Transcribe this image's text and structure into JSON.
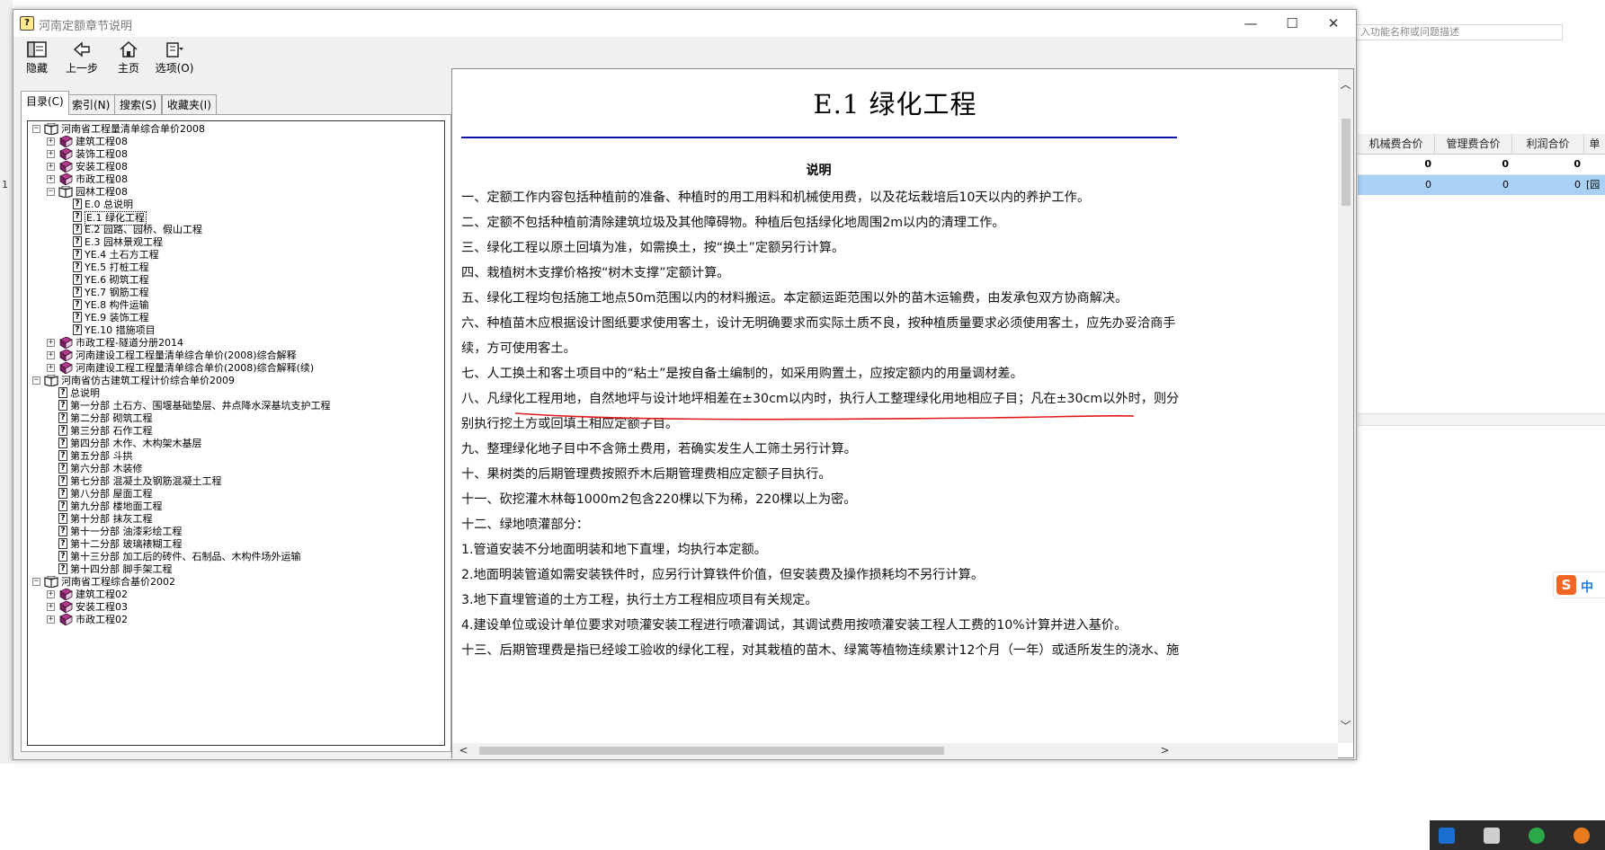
{
  "background_app": {
    "search_placeholder": "入功能名称或问题描述",
    "row_number": "1",
    "columns": [
      "机械费合价",
      "管理费合价",
      "利润合价",
      "单"
    ],
    "row1": [
      "0",
      "0",
      "0"
    ],
    "row2": [
      "0",
      "0",
      "0",
      "[园"
    ]
  },
  "window": {
    "title": "河南定额章节说明",
    "minimize": "—",
    "maximize": "☐",
    "close": "✕"
  },
  "toolbar": {
    "hide": "隐藏",
    "back": "上一步",
    "home": "主页",
    "options": "选项(O)"
  },
  "nav_tabs": [
    "目录(C)",
    "索引(N)",
    "搜索(S)",
    "收藏夹(I)"
  ],
  "tree": [
    {
      "level": 0,
      "type": "book-open",
      "toggle": "−",
      "label": "河南省工程量清单综合单价2008"
    },
    {
      "level": 1,
      "type": "book",
      "toggle": "+",
      "label": "建筑工程08"
    },
    {
      "level": 1,
      "type": "book",
      "toggle": "+",
      "label": "装饰工程08"
    },
    {
      "level": 1,
      "type": "book",
      "toggle": "+",
      "label": "安装工程08"
    },
    {
      "level": 1,
      "type": "book",
      "toggle": "+",
      "label": "市政工程08"
    },
    {
      "level": 1,
      "type": "book-open",
      "toggle": "−",
      "label": "园林工程08"
    },
    {
      "level": 2,
      "type": "page",
      "label": "E.0 总说明"
    },
    {
      "level": 2,
      "type": "page",
      "label": "E.1 绿化工程",
      "selected": true
    },
    {
      "level": 2,
      "type": "page",
      "label": "E.2 园路、园桥、假山工程"
    },
    {
      "level": 2,
      "type": "page",
      "label": "E.3 园林景观工程"
    },
    {
      "level": 2,
      "type": "page",
      "label": "YE.4 土石方工程"
    },
    {
      "level": 2,
      "type": "page",
      "label": "YE.5 打桩工程"
    },
    {
      "level": 2,
      "type": "page",
      "label": "YE.6 砌筑工程"
    },
    {
      "level": 2,
      "type": "page",
      "label": "YE.7 钢筋工程"
    },
    {
      "level": 2,
      "type": "page",
      "label": "YE.8 构件运输"
    },
    {
      "level": 2,
      "type": "page",
      "label": "YE.9 装饰工程"
    },
    {
      "level": 2,
      "type": "page",
      "label": "YE.10 措施项目"
    },
    {
      "level": 1,
      "type": "book",
      "toggle": "+",
      "label": "市政工程-隧道分册2014"
    },
    {
      "level": 1,
      "type": "book",
      "toggle": "+",
      "label": "河南建设工程工程量清单综合单价(2008)综合解释"
    },
    {
      "level": 1,
      "type": "book",
      "toggle": "+",
      "label": "河南建设工程工程量清单综合单价(2008)综合解释(续)"
    },
    {
      "level": 0,
      "type": "book-open",
      "toggle": "−",
      "label": "河南省仿古建筑工程计价综合单价2009"
    },
    {
      "level": 1,
      "type": "page",
      "label": "总说明"
    },
    {
      "level": 1,
      "type": "page",
      "label": "第一分部 土石方、围堰基础垫层、井点降水深基坑支护工程"
    },
    {
      "level": 1,
      "type": "page",
      "label": "第二分部 砌筑工程"
    },
    {
      "level": 1,
      "type": "page",
      "label": "第三分部 石作工程"
    },
    {
      "level": 1,
      "type": "page",
      "label": "第四分部 木作、木构架木基层"
    },
    {
      "level": 1,
      "type": "page",
      "label": "第五分部 斗拱"
    },
    {
      "level": 1,
      "type": "page",
      "label": "第六分部 木装修"
    },
    {
      "level": 1,
      "type": "page",
      "label": "第七分部 混凝土及钢筋混凝土工程"
    },
    {
      "level": 1,
      "type": "page",
      "label": "第八分部 屋面工程"
    },
    {
      "level": 1,
      "type": "page",
      "label": "第九分部 楼地面工程"
    },
    {
      "level": 1,
      "type": "page",
      "label": "第十分部 抹灰工程"
    },
    {
      "level": 1,
      "type": "page",
      "label": "第十一分部 油漆彩绘工程"
    },
    {
      "level": 1,
      "type": "page",
      "label": "第十二分部 玻璃裱糊工程"
    },
    {
      "level": 1,
      "type": "page",
      "label": "第十三分部 加工后的砖件、石制品、木构件场外运输"
    },
    {
      "level": 1,
      "type": "page",
      "label": "第十四分部 脚手架工程"
    },
    {
      "level": 0,
      "type": "book-open",
      "toggle": "−",
      "label": "河南省工程综合基价2002"
    },
    {
      "level": 1,
      "type": "book",
      "toggle": "+",
      "label": "建筑工程02"
    },
    {
      "level": 1,
      "type": "book",
      "toggle": "+",
      "label": "安装工程03"
    },
    {
      "level": 1,
      "type": "book",
      "toggle": "+",
      "label": "市政工程02"
    }
  ],
  "document": {
    "title": "E.1 绿化工程",
    "subtitle": "说明",
    "paragraphs": [
      "一、定额工作内容包括种植前的准备、种植时的用工用料和机械使用费，以及花坛栽培后10天以内的养护工作。",
      "二、定额不包括种植前清除建筑垃圾及其他障碍物。种植后包括绿化地周围2m以内的清理工作。",
      "三、绿化工程以原土回填为准，如需换土，按“换土”定额另行计算。",
      "四、栽植树木支撑价格按“树木支撑”定额计算。",
      "五、绿化工程均包括施工地点50m范围以内的材料搬运。本定额运距范围以外的苗木运输费，由发承包双方协商解决。",
      "六、种植苗木应根据设计图纸要求使用客土，设计无明确要求而实际土质不良，按种植质量要求必须使用客土，应先办妥洽商手续，方可使用客土。",
      "七、人工换土和客土项目中的“粘土”是按自备土编制的，如采用购置土，应按定额内的用量调材差。",
      "八、凡绿化工程用地，自然地坪与设计地坪相差在±30cm以内时，执行人工整理绿化用地相应子目；凡在±30cm以外时，则分别执行挖土方或回填土相应定额子目。",
      "九、整理绿化地子目中不含筛土费用，若确实发生人工筛土另行计算。",
      "十、果树类的后期管理费按照乔木后期管理费相应定额子目执行。",
      "十一、砍挖灌木林每1000m2包含220棵以下为稀，220棵以上为密。",
      "十二、绿地喷灌部分：",
      "1.管道安装不分地面明装和地下直埋，均执行本定额。",
      "2.地面明装管道如需安装铁件时，应另行计算铁件价值，但安装费及操作损耗均不另行计算。",
      "3.地下直埋管道的土方工程，执行土方工程相应项目有关规定。",
      "4.建设单位或设计单位要求对喷灌安装工程进行喷灌调试，其调试费用按喷灌安装工程人工费的10%计算并进入基价。",
      "十三、后期管理费是指已经竣工验收的绿化工程，对其栽植的苗木、绿篱等植物连续累计12个月（一年）或适所发生的浇水、施"
    ]
  },
  "scroll": {
    "up": "︿",
    "down": "﹀",
    "left": "<",
    "right": ">"
  }
}
